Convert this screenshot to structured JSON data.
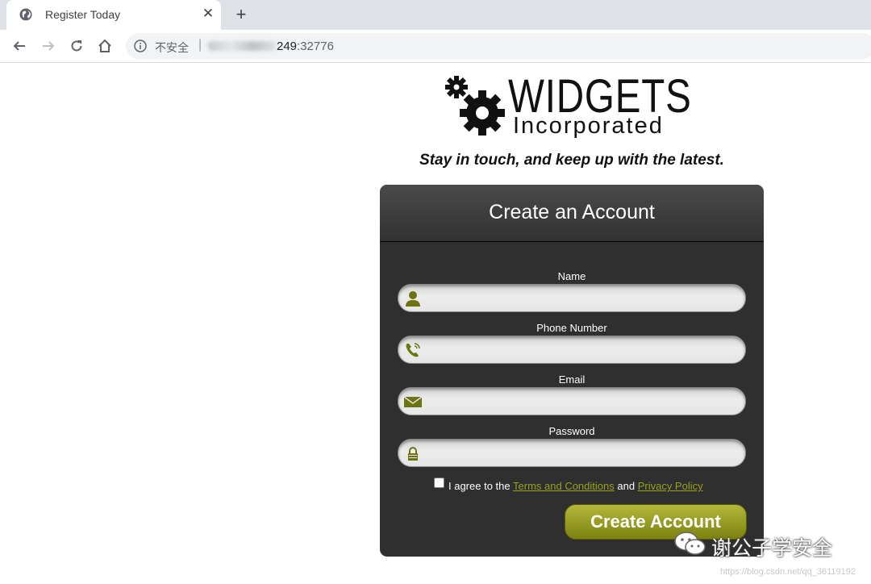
{
  "browser": {
    "tab_title": "Register Today",
    "close_symbol": "✕",
    "new_tab_symbol": "+",
    "security_text": "不安全",
    "separator": "|",
    "url_host_visible": "249",
    "url_port": ":32776"
  },
  "logo": {
    "line1": "WIDGETS",
    "line2": "Incorporated"
  },
  "tagline": "Stay in touch, and keep up with the latest.",
  "form": {
    "heading": "Create an Account",
    "fields": [
      {
        "label": "Name",
        "icon": "user-icon",
        "value": ""
      },
      {
        "label": "Phone Number",
        "icon": "phone-icon",
        "value": ""
      },
      {
        "label": "Email",
        "icon": "envelope-icon",
        "value": ""
      },
      {
        "label": "Password",
        "icon": "lock-icon",
        "value": ""
      }
    ],
    "agree_prefix": "I agree to the",
    "terms_link": "Terms and Conditions",
    "agree_and": "and",
    "privacy_link": "Privacy Policy",
    "checkbox_checked": false,
    "submit_label": "Create Account",
    "accent_color": "#9aa11a"
  },
  "watermark": {
    "text": "谢公子学安全",
    "url": "https://blog.csdn.net/qq_36119192"
  }
}
